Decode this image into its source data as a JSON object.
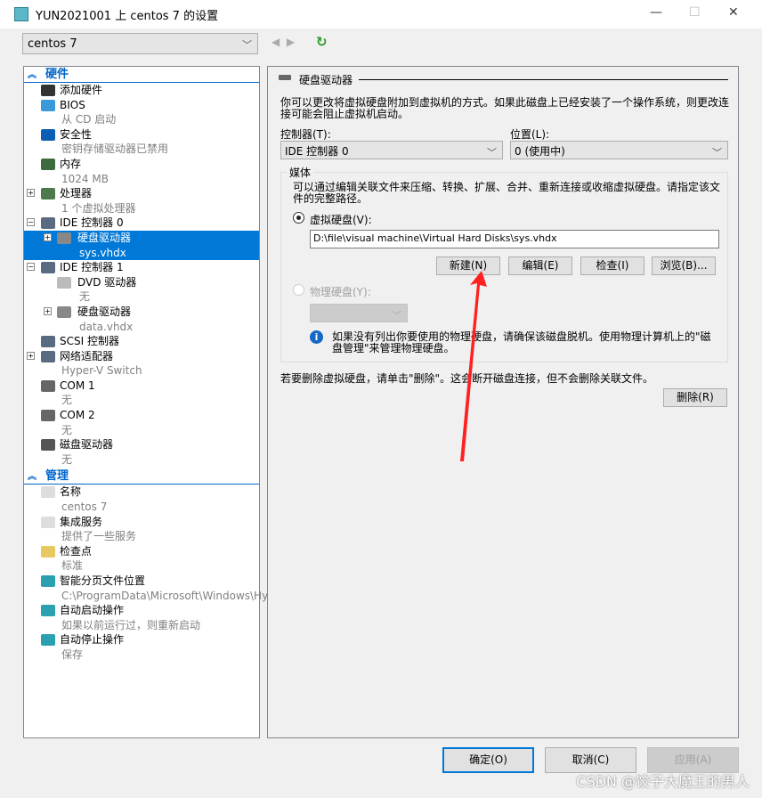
{
  "window": {
    "title": "YUN2021001 上 centos 7 的设置",
    "vm_select": "centos 7"
  },
  "tree": {
    "hardware_header": "硬件",
    "hardware": [
      {
        "label": "添加硬件",
        "icon": "add-hardware-icon",
        "color": "#333333"
      },
      {
        "label": "BIOS",
        "sub": "从 CD 启动",
        "icon": "monitor-icon",
        "color": "#3a9ad9"
      },
      {
        "label": "安全性",
        "sub": "密钥存储驱动器已禁用",
        "icon": "shield-icon",
        "color": "#0a5fb4"
      },
      {
        "label": "内存",
        "sub": "1024 MB",
        "icon": "memory-icon",
        "color": "#3d6b3d"
      },
      {
        "label": "处理器",
        "sub": "1 个虚拟处理器",
        "icon": "cpu-icon",
        "color": "#4d7a4d",
        "expander": "+"
      },
      {
        "label": "IDE 控制器 0",
        "icon": "controller-icon",
        "color": "#5a6a80",
        "expander": "−"
      },
      {
        "label": "硬盘驱动器",
        "sub": "sys.vhdx",
        "icon": "hard-drive-icon",
        "color": "#888888",
        "expander": "+",
        "child": true,
        "selected": true
      },
      {
        "label": "IDE 控制器 1",
        "icon": "controller-icon",
        "color": "#5a6a80",
        "expander": "−"
      },
      {
        "label": "DVD 驱动器",
        "sub": "无",
        "icon": "dvd-icon",
        "color": "#bbbbbb",
        "child": true
      },
      {
        "label": "硬盘驱动器",
        "sub": "data.vhdx",
        "icon": "hard-drive-icon",
        "color": "#888888",
        "expander": "+",
        "child": true
      },
      {
        "label": "SCSI 控制器",
        "icon": "scsi-icon",
        "color": "#5a6a80"
      },
      {
        "label": "网络适配器",
        "sub": "Hyper-V Switch",
        "icon": "network-adapter-icon",
        "color": "#5a6a80",
        "expander": "+"
      },
      {
        "label": "COM 1",
        "sub": "无",
        "icon": "com-port-icon",
        "color": "#666666"
      },
      {
        "label": "COM 2",
        "sub": "无",
        "icon": "com-port-icon",
        "color": "#666666"
      },
      {
        "label": "磁盘驱动器",
        "sub": "无",
        "icon": "floppy-icon",
        "color": "#555555"
      }
    ],
    "management_header": "管理",
    "management": [
      {
        "label": "名称",
        "sub": "centos 7",
        "icon": "name-icon",
        "color": "#dddddd"
      },
      {
        "label": "集成服务",
        "sub": "提供了一些服务",
        "icon": "integration-services-icon",
        "color": "#dddddd"
      },
      {
        "label": "检查点",
        "sub": "标准",
        "icon": "checkpoint-icon",
        "color": "#e8c860"
      },
      {
        "label": "智能分页文件位置",
        "sub": "C:\\ProgramData\\Microsoft\\Windows\\Hype...",
        "icon": "smart-paging-icon",
        "color": "#2aa0b0"
      },
      {
        "label": "自动启动操作",
        "sub": "如果以前运行过，则重新启动",
        "icon": "auto-start-icon",
        "color": "#2aa0b0"
      },
      {
        "label": "自动停止操作",
        "sub": "保存",
        "icon": "auto-stop-icon",
        "color": "#2aa0b0"
      }
    ]
  },
  "panel": {
    "heading": "硬盘驱动器",
    "description": "你可以更改将虚拟硬盘附加到虚拟机的方式。如果此磁盘上已经安装了一个操作系统，则更改连接可能会阻止虚拟机启动。",
    "controller_label": "控制器(T):",
    "controller_value": "IDE 控制器 0",
    "location_label": "位置(L):",
    "location_value": "0 (使用中)",
    "media_label": "媒体",
    "media_desc": "可以通过编辑关联文件来压缩、转换、扩展、合并、重新连接或收缩虚拟硬盘。请指定该文件的完整路径。",
    "vhd_radio": "虚拟硬盘(V):",
    "vhd_path": "D:\\file\\visual machine\\Virtual Hard Disks\\sys.vhdx",
    "buttons": {
      "new": "新建(N)",
      "edit": "编辑(E)",
      "inspect": "检查(I)",
      "browse": "浏览(B)..."
    },
    "physical_radio": "物理硬盘(Y):",
    "info": "如果没有列出你要使用的物理硬盘，请确保该磁盘脱机。使用物理计算机上的\"磁盘管理\"来管理物理硬盘。",
    "remove_desc": "若要删除虚拟硬盘，请单击\"删除\"。这会断开磁盘连接，但不会删除关联文件。",
    "remove": "删除(R)"
  },
  "footer": {
    "ok": "确定(O)",
    "cancel": "取消(C)",
    "apply": "应用(A)"
  },
  "watermark": "CSDN @饺子大魔王的男人",
  "colors": {
    "accent": "#0078d7",
    "annotation_arrow": "#ff2020"
  }
}
